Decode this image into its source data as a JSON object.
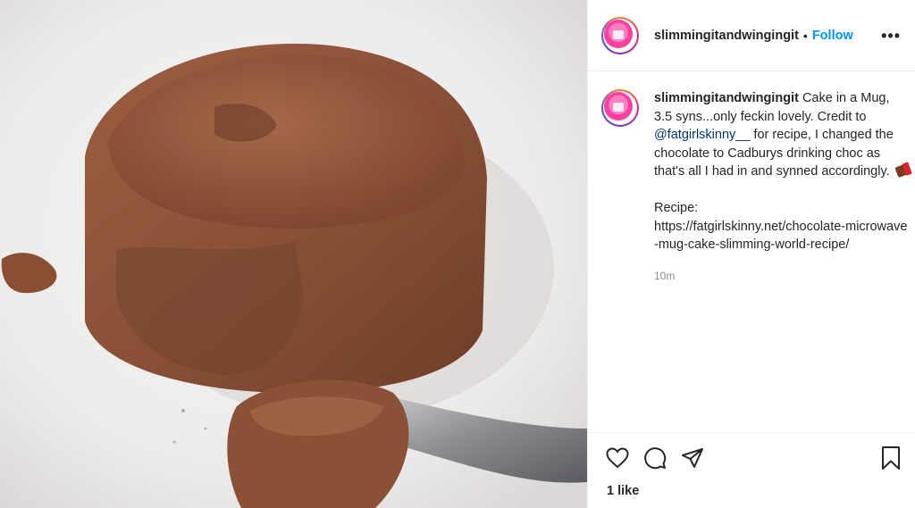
{
  "post": {
    "username": "slimmingitandwingingit",
    "follow_label": "Follow",
    "separator": "•",
    "more_label": "•••",
    "caption": {
      "username": "slimmingitandwingingit",
      "text_1": " Cake in a Mug, 3.5 syns...only feckin lovely. Credit to ",
      "mention": "@fatgirlskinny__",
      "text_2": " for recipe, I changed the chocolate to Cadburys drinking choc as that's all I had in and synned accordingly. ",
      "recipe_label": "Recipe:",
      "recipe_url": "https://fatgirlskinny.net/chocolate-microwave-mug-cake-slimming-world-recipe/"
    },
    "time_ago": "10m",
    "likes": "1 like"
  },
  "icons": {
    "like": "heart-icon",
    "comment": "comment-icon",
    "share": "paper-plane-icon",
    "save": "bookmark-icon",
    "more": "more-options-icon",
    "emoji": "chocolate-bar-icon"
  },
  "colors": {
    "follow": "#0095f6",
    "mention": "#00376b",
    "muted": "#8e8e8e",
    "text": "#262626",
    "border": "#efefef",
    "cake": "#8a5137"
  }
}
